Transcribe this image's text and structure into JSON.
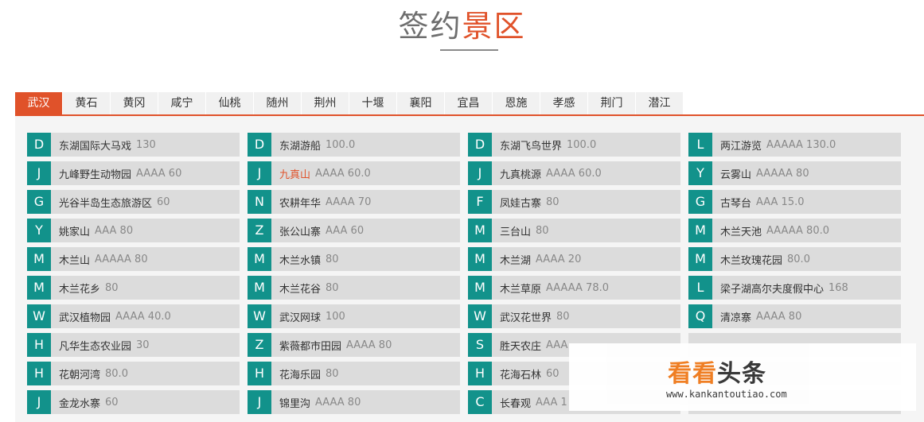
{
  "section_title": {
    "part1": "签约",
    "part2": "景区"
  },
  "tabs": [
    "武汉",
    "黄石",
    "黄冈",
    "咸宁",
    "仙桃",
    "随州",
    "荆州",
    "十堰",
    "襄阳",
    "宜昌",
    "恩施",
    "孝感",
    "荆门",
    "潜江"
  ],
  "active_tab": "武汉",
  "colors": {
    "accent": "#e0522a",
    "letter_badge": "#12928b",
    "cell_bg": "#dcdcdc"
  },
  "scenic_spots": [
    {
      "letter": "D",
      "name": "东湖国际大马戏",
      "info": "130"
    },
    {
      "letter": "D",
      "name": "东湖游船",
      "info": "100.0"
    },
    {
      "letter": "D",
      "name": "东湖飞鸟世界",
      "info": "100.0"
    },
    {
      "letter": "L",
      "name": "两江游览",
      "info": "AAAAA 130.0"
    },
    {
      "letter": "J",
      "name": "九峰野生动物园",
      "info": "AAAA 60"
    },
    {
      "letter": "J",
      "name": "九真山",
      "info": "AAAA 60.0",
      "highlight": true
    },
    {
      "letter": "J",
      "name": "九真桃源",
      "info": "AAAA 60.0"
    },
    {
      "letter": "Y",
      "name": "云雾山",
      "info": "AAAAA 80"
    },
    {
      "letter": "G",
      "name": "光谷半岛生态旅游区",
      "info": "60"
    },
    {
      "letter": "N",
      "name": "农耕年华",
      "info": "AAAA 70"
    },
    {
      "letter": "F",
      "name": "凤娃古寨",
      "info": "80"
    },
    {
      "letter": "G",
      "name": "古琴台",
      "info": "AAA 15.0"
    },
    {
      "letter": "Y",
      "name": "姚家山",
      "info": "AAA 80"
    },
    {
      "letter": "Z",
      "name": "张公山寨",
      "info": "AAA 60"
    },
    {
      "letter": "M",
      "name": "三台山",
      "info": "80"
    },
    {
      "letter": "M",
      "name": "木兰天池",
      "info": "AAAAA 80.0"
    },
    {
      "letter": "M",
      "name": "木兰山",
      "info": "AAAAA 80"
    },
    {
      "letter": "M",
      "name": "木兰水镇",
      "info": "80"
    },
    {
      "letter": "M",
      "name": "木兰湖",
      "info": "AAAA 20"
    },
    {
      "letter": "M",
      "name": "木兰玫瑰花园",
      "info": "80.0"
    },
    {
      "letter": "M",
      "name": "木兰花乡",
      "info": "80"
    },
    {
      "letter": "M",
      "name": "木兰花谷",
      "info": "80"
    },
    {
      "letter": "M",
      "name": "木兰草原",
      "info": "AAAAA 78.0"
    },
    {
      "letter": "L",
      "name": "梁子湖高尔夫度假中心",
      "info": "168"
    },
    {
      "letter": "W",
      "name": "武汉植物园",
      "info": "AAAA 40.0"
    },
    {
      "letter": "W",
      "name": "武汉网球",
      "info": "100"
    },
    {
      "letter": "W",
      "name": "武汉花世界",
      "info": "80"
    },
    {
      "letter": "Q",
      "name": "清凉寨",
      "info": "AAAA 80"
    },
    {
      "letter": "H",
      "name": "凡华生态农业园",
      "info": "30"
    },
    {
      "letter": "Z",
      "name": "紫薇都市田园",
      "info": "AAAA 80"
    },
    {
      "letter": "S",
      "name": "胜天农庄",
      "info": "AAA"
    },
    {
      "letter": "",
      "name": "",
      "info": ""
    },
    {
      "letter": "H",
      "name": "花朝河湾",
      "info": "80.0"
    },
    {
      "letter": "H",
      "name": "花海乐园",
      "info": "80"
    },
    {
      "letter": "H",
      "name": "花海石林",
      "info": "60"
    },
    {
      "letter": "",
      "name": "",
      "info": ""
    },
    {
      "letter": "J",
      "name": "金龙水寨",
      "info": "60"
    },
    {
      "letter": "J",
      "name": "锦里沟",
      "info": "AAAA 80"
    },
    {
      "letter": "C",
      "name": "长春观",
      "info": "AAA 1"
    },
    {
      "letter": "",
      "name": "",
      "info": ""
    }
  ],
  "watermark": {
    "logo_part1": "看看",
    "logo_part2": "头条",
    "url": "www.kankantoutiao.com"
  }
}
